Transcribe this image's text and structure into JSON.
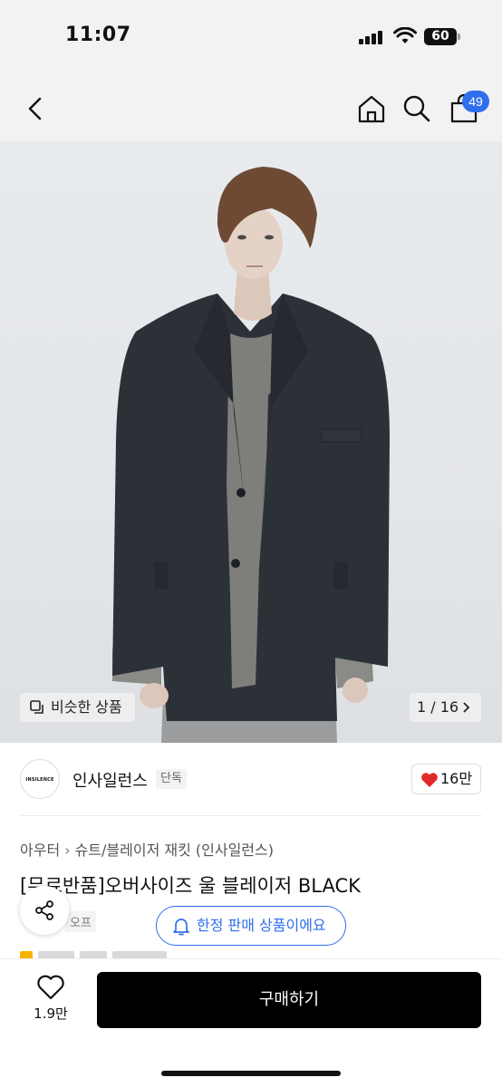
{
  "status_bar": {
    "time": "11:07",
    "battery_level": "60",
    "icons": [
      "cellular-signal-icon",
      "wifi-icon",
      "battery-icon"
    ]
  },
  "nav": {
    "icons": [
      "back-chevron-icon",
      "home-icon",
      "search-icon",
      "cart-icon"
    ],
    "cart_count": "49",
    "accent_color": "#2f6fed"
  },
  "gallery": {
    "similar_label": "비슷한 상품",
    "page_indicator": "1 / 16"
  },
  "brand": {
    "logo_text": "INSILENCE",
    "name": "인사일런스",
    "tag": "단독",
    "likes": "16만"
  },
  "product": {
    "category": [
      "아우터",
      "슈트/블레이저 재킷 (인사일런스)"
    ],
    "title": "[무료반품]오버사이즈 울 블레이저 BLACK",
    "sub_tag": "오프",
    "limited_notice": "한정 판매 상품이에요"
  },
  "bottom_bar": {
    "wish_count": "1.9만",
    "buy_label": "구매하기",
    "heart_color": "#e12b2b"
  }
}
